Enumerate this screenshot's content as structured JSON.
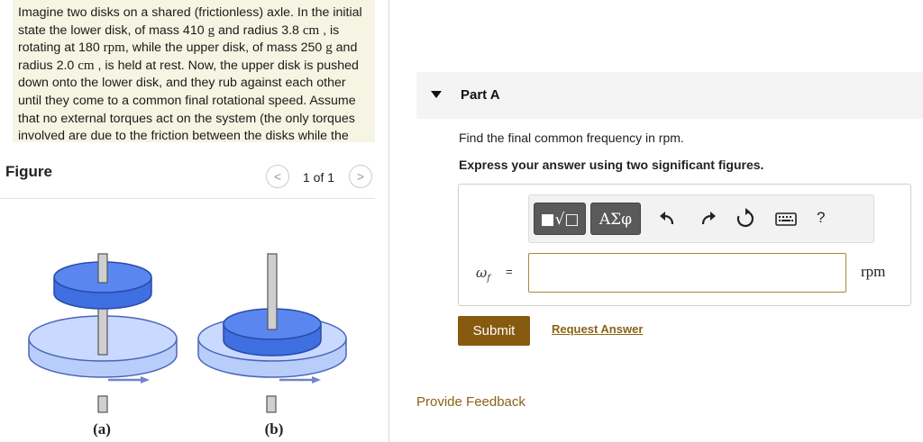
{
  "problem": {
    "text_1": "Imagine two disks on a shared (frictionless) axle. In the initial state the lower disk, of mass 410 ",
    "u_g1": "g",
    "text_2": " and radius 3.8 ",
    "u_cm1": "cm",
    "text_3": " , is rotating at 180 ",
    "u_rpm": "rpm",
    "text_4": ", while the upper disk, of mass 250 ",
    "u_g2": "g",
    "text_5": " and radius 2.0 ",
    "u_cm2": "cm",
    "text_6": " , is held at rest. Now, the upper disk is pushed down onto the lower disk, and they rub against each other until they come to a common final rotational speed. Assume that no external torques act on the system (the only torques involved are due to the friction between the disks while the upper disk is"
  },
  "figure": {
    "title": "Figure",
    "pager": "1 of 1",
    "prev_glyph": "<",
    "next_glyph": ">",
    "label_a": "(a)",
    "label_b": "(b)"
  },
  "part": {
    "label": "Part A",
    "question": "Find the final common frequency in rpm.",
    "instruction": "Express your answer using two significant figures.",
    "toolbar": {
      "templates_label": "■√□",
      "greek_label": "ΑΣφ",
      "help_label": "?"
    },
    "lhs_symbol": "ω",
    "lhs_sub": "f",
    "equals": "=",
    "answer_value": "",
    "unit": "rpm",
    "submit_label": "Submit",
    "request_label": "Request Answer"
  },
  "feedback_label": "Provide Feedback",
  "colors": {
    "problem_bg": "#f6f5e3",
    "accent_gold": "#865a0f",
    "link_gold": "#8a6316",
    "disk_blue": "#3f6fe0",
    "disk_light": "#b9cdfa"
  }
}
